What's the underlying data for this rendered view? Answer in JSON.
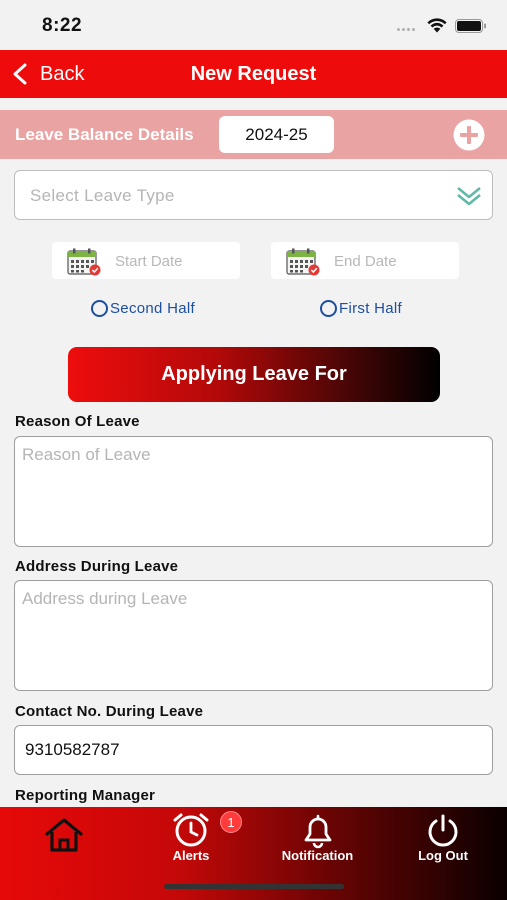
{
  "status": {
    "time": "8:22"
  },
  "nav": {
    "back_label": "Back",
    "title": "New Request"
  },
  "balance": {
    "label": "Leave Balance Details",
    "year": "2024-25"
  },
  "form": {
    "leave_type_placeholder": "Select Leave Type",
    "start_date_placeholder": "Start Date",
    "end_date_placeholder": "End Date",
    "second_half_label": "Second Half",
    "first_half_label": "First Half",
    "apply_button_label": "Applying Leave For",
    "reason_label": "Reason Of Leave",
    "reason_placeholder": "Reason of Leave",
    "address_label": "Address During Leave",
    "address_placeholder": "Address during Leave",
    "contact_label": "Contact No. During Leave",
    "contact_value": "9310582787",
    "manager_label": "Reporting Manager"
  },
  "tabs": {
    "home_icon": "home-icon",
    "alerts_label": "Alerts",
    "alerts_badge": "1",
    "notification_label": "Notification",
    "logout_label": "Log Out"
  },
  "colors": {
    "primary": "#ee0b0b",
    "balance_bar": "#e9a3a3",
    "radio": "#1d4fa0"
  }
}
